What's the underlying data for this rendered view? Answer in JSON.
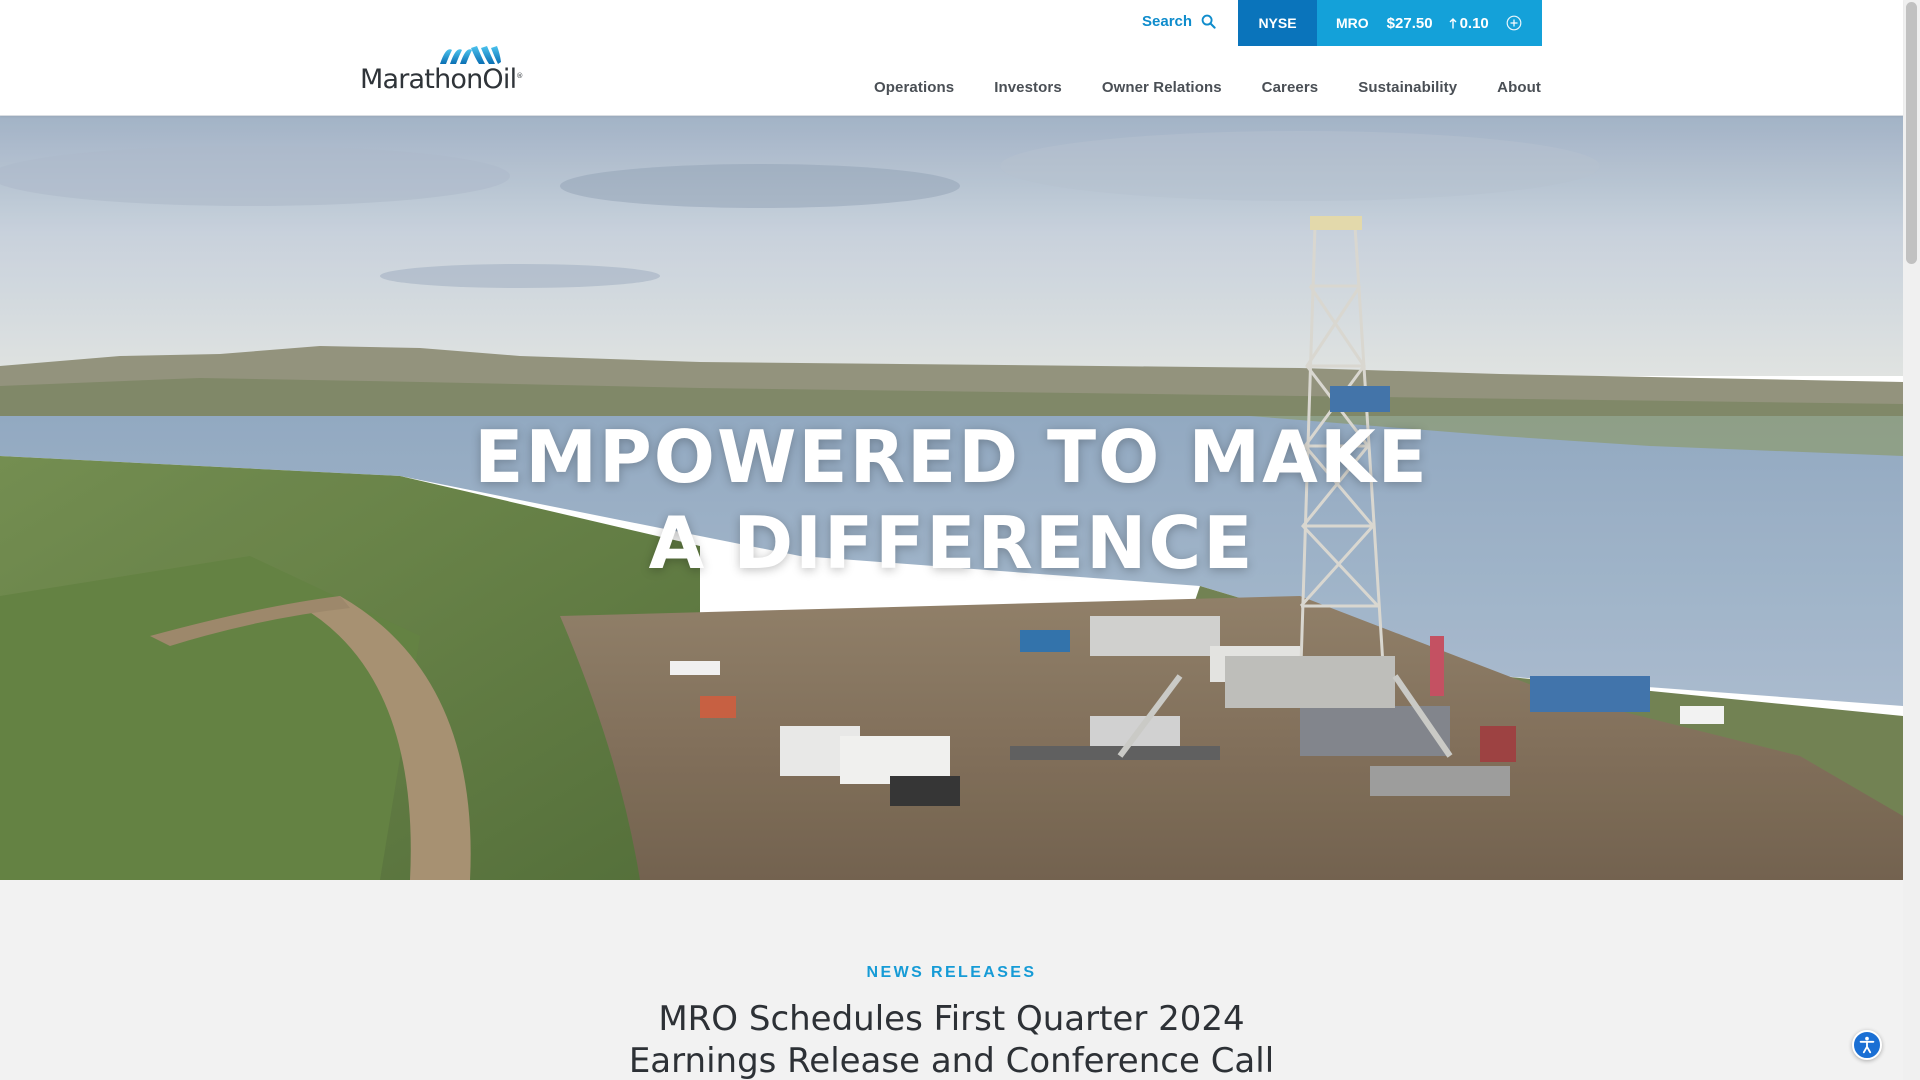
{
  "brand": {
    "name": "Marathon Oil",
    "name_part1": "Marathon",
    "name_part2": "Oil",
    "logo_icon": "marathon-wave-logo"
  },
  "search": {
    "label": "Search",
    "icon": "search-icon"
  },
  "stock": {
    "exchange": "NYSE",
    "symbol": "MRO",
    "price": "$27.50",
    "change": "0.10",
    "change_direction": "up",
    "expand_icon": "plus-circle-icon"
  },
  "nav": {
    "items": [
      {
        "label": "Operations"
      },
      {
        "label": "Investors"
      },
      {
        "label": "Owner Relations"
      },
      {
        "label": "Careers"
      },
      {
        "label": "Sustainability"
      },
      {
        "label": "About"
      }
    ]
  },
  "hero": {
    "title_line1": "EMPOWERED TO MAKE",
    "title_line2": "A DIFFERENCE"
  },
  "news": {
    "kicker": "NEWS RELEASES",
    "headline_line1": "MRO Schedules First Quarter 2024",
    "headline_line2": "Earnings Release and Conference Call"
  },
  "colors": {
    "brand_blue": "#0a74bb",
    "accent_cyan": "#14a1d9",
    "link_blue": "#0f8ccc",
    "nav_text": "#4a4f55"
  }
}
